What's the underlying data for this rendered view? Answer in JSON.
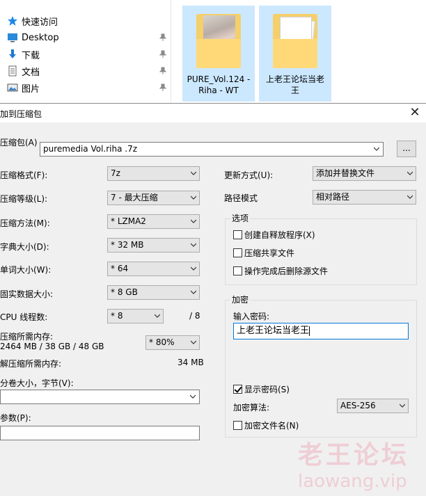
{
  "explorer": {
    "nav": [
      {
        "label": "快速访问",
        "icon": "star-icon"
      },
      {
        "label": "Desktop",
        "icon": "desktop-icon"
      },
      {
        "label": "下载",
        "icon": "download-arrow-icon"
      },
      {
        "label": "文档",
        "icon": "document-icon"
      },
      {
        "label": "图片",
        "icon": "picture-icon"
      }
    ],
    "files": [
      {
        "line1": "PURE_Vol.124 -",
        "line2": "Riha - WT"
      },
      {
        "line1": "上老王论坛当老",
        "line2": "王"
      }
    ]
  },
  "dialog": {
    "title": "加到压缩包",
    "close": "✕",
    "archive_label": "压缩包(A)",
    "archive_path": "puremedia Vol.riha .7z",
    "browse_label": "...",
    "format_label": "压缩格式(F):",
    "format_value": "7z",
    "level_label": "压缩等级(L):",
    "level_value": "7 - 最大压缩",
    "method_label": "压缩方法(M):",
    "method_value": "* LZMA2",
    "dict_label": "字典大小(D):",
    "dict_value": "* 32 MB",
    "word_label": "单词大小(W):",
    "word_value": "* 64",
    "solid_label": "固实数据大小:",
    "solid_value": "* 8 GB",
    "threads_label": "CPU 线程数:",
    "threads_value": "* 8",
    "threads_total": "/ 8",
    "mem_comp_label": "压缩所需内存:",
    "mem_comp_detail": "2464 MB / 38 GB / 48 GB",
    "mem_comp_value": "* 80%",
    "mem_decomp_label": "解压缩所需内存:",
    "mem_decomp_value": "34 MB",
    "volume_label": "分卷大小，字节(V):",
    "volume_value": "",
    "params_label": "参数(P):",
    "params_value": "",
    "update_label": "更新方式(U):",
    "update_value": "添加并替换文件",
    "path_label": "路径模式",
    "path_value": "相对路径",
    "options_title": "选项",
    "options": [
      {
        "label": "创建自释放程序(X)",
        "checked": false
      },
      {
        "label": "压缩共享文件",
        "checked": false
      },
      {
        "label": "操作完成后删除源文件",
        "checked": false
      }
    ],
    "encrypt_title": "加密",
    "password_label": "输入密码:",
    "password_value": "上老王论坛当老王",
    "show_password_label": "显示密码(S)",
    "show_password_checked": true,
    "enc_method_label": "加密算法:",
    "enc_method_value": "AES-256",
    "encrypt_names_label": "加密文件名(N)",
    "encrypt_names_checked": false
  },
  "watermark": {
    "line1": "老王论坛",
    "line2": "laowang.vip"
  }
}
